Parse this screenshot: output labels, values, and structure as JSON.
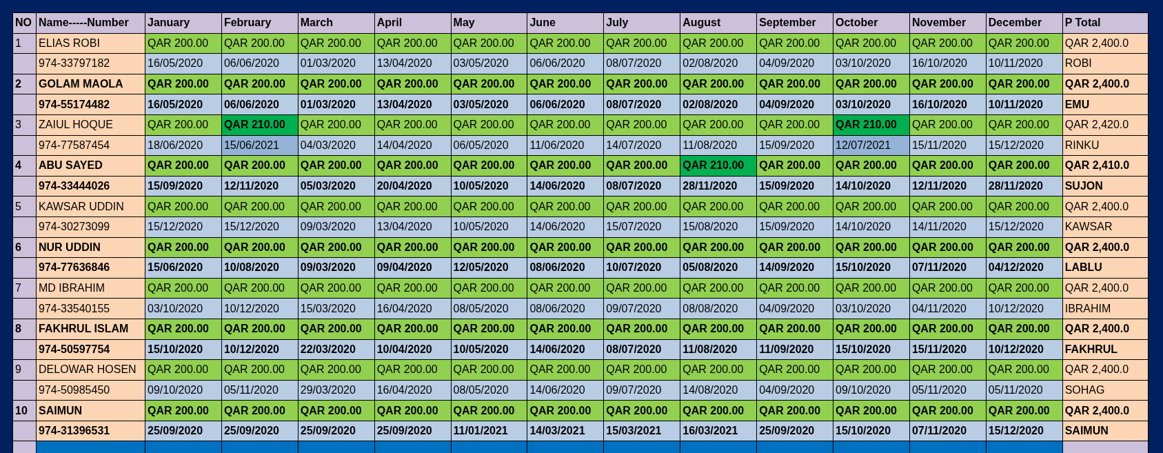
{
  "columns": [
    "NO",
    "Name-----Number",
    "January",
    "February",
    "March",
    "April",
    "May",
    "June",
    "July",
    "August",
    "September",
    "October",
    "November",
    "December",
    "P Total"
  ],
  "members": [
    {
      "no": "1",
      "name": "ELIAS ROBI",
      "phone": "974-33797182",
      "bold": false,
      "total": "QAR 2,400.0",
      "nickname": "ROBI",
      "payments": [
        {
          "amount": "QAR 200.00",
          "date": "16/05/2020",
          "amount_flagged": false,
          "date_flagged": false
        },
        {
          "amount": "QAR 200.00",
          "date": "06/06/2020",
          "amount_flagged": false,
          "date_flagged": false
        },
        {
          "amount": "QAR 200.00",
          "date": "01/03/2020",
          "amount_flagged": false,
          "date_flagged": false
        },
        {
          "amount": "QAR 200.00",
          "date": "13/04/2020",
          "amount_flagged": false,
          "date_flagged": false
        },
        {
          "amount": "QAR 200.00",
          "date": "03/05/2020",
          "amount_flagged": false,
          "date_flagged": false
        },
        {
          "amount": "QAR 200.00",
          "date": "06/06/2020",
          "amount_flagged": false,
          "date_flagged": false
        },
        {
          "amount": "QAR 200.00",
          "date": "08/07/2020",
          "amount_flagged": false,
          "date_flagged": false
        },
        {
          "amount": "QAR 200.00",
          "date": "02/08/2020",
          "amount_flagged": false,
          "date_flagged": false
        },
        {
          "amount": "QAR 200.00",
          "date": "04/09/2020",
          "amount_flagged": false,
          "date_flagged": false
        },
        {
          "amount": "QAR 200.00",
          "date": "03/10/2020",
          "amount_flagged": false,
          "date_flagged": false
        },
        {
          "amount": "QAR 200.00",
          "date": "16/10/2020",
          "amount_flagged": false,
          "date_flagged": false
        },
        {
          "amount": "QAR 200.00",
          "date": "10/11/2020",
          "amount_flagged": false,
          "date_flagged": false
        }
      ]
    },
    {
      "no": "2",
      "name": "GOLAM MAOLA",
      "phone": "974-55174482",
      "bold": true,
      "total": "QAR 2,400.0",
      "nickname": "EMU",
      "payments": [
        {
          "amount": "QAR 200.00",
          "date": "16/05/2020",
          "amount_flagged": false,
          "date_flagged": false
        },
        {
          "amount": "QAR 200.00",
          "date": "06/06/2020",
          "amount_flagged": false,
          "date_flagged": false
        },
        {
          "amount": "QAR 200.00",
          "date": "01/03/2020",
          "amount_flagged": false,
          "date_flagged": false
        },
        {
          "amount": "QAR 200.00",
          "date": "13/04/2020",
          "amount_flagged": false,
          "date_flagged": false
        },
        {
          "amount": "QAR 200.00",
          "date": "03/05/2020",
          "amount_flagged": false,
          "date_flagged": false
        },
        {
          "amount": "QAR 200.00",
          "date": "06/06/2020",
          "amount_flagged": false,
          "date_flagged": false
        },
        {
          "amount": "QAR 200.00",
          "date": "08/07/2020",
          "amount_flagged": false,
          "date_flagged": false
        },
        {
          "amount": "QAR 200.00",
          "date": "02/08/2020",
          "amount_flagged": false,
          "date_flagged": false
        },
        {
          "amount": "QAR 200.00",
          "date": "04/09/2020",
          "amount_flagged": false,
          "date_flagged": false
        },
        {
          "amount": "QAR 200.00",
          "date": "03/10/2020",
          "amount_flagged": false,
          "date_flagged": false
        },
        {
          "amount": "QAR 200.00",
          "date": "16/10/2020",
          "amount_flagged": false,
          "date_flagged": false
        },
        {
          "amount": "QAR 200.00",
          "date": "10/11/2020",
          "amount_flagged": false,
          "date_flagged": false
        }
      ]
    },
    {
      "no": "3",
      "name": "ZAIUL HOQUE",
      "phone": "974-77587454",
      "bold": false,
      "total": "QAR 2,420.0",
      "nickname": "RINKU",
      "payments": [
        {
          "amount": "QAR 200.00",
          "date": "18/06/2020",
          "amount_flagged": false,
          "date_flagged": false
        },
        {
          "amount": "QAR 210.00",
          "date": "15/06/2021",
          "amount_flagged": true,
          "date_flagged": true
        },
        {
          "amount": "QAR 200.00",
          "date": "04/03/2020",
          "amount_flagged": false,
          "date_flagged": false
        },
        {
          "amount": "QAR 200.00",
          "date": "14/04/2020",
          "amount_flagged": false,
          "date_flagged": false
        },
        {
          "amount": "QAR 200.00",
          "date": "06/05/2020",
          "amount_flagged": false,
          "date_flagged": false
        },
        {
          "amount": "QAR 200.00",
          "date": "11/06/2020",
          "amount_flagged": false,
          "date_flagged": false
        },
        {
          "amount": "QAR 200.00",
          "date": "14/07/2020",
          "amount_flagged": false,
          "date_flagged": false
        },
        {
          "amount": "QAR 200.00",
          "date": "11/08/2020",
          "amount_flagged": false,
          "date_flagged": false
        },
        {
          "amount": "QAR 200.00",
          "date": "15/09/2020",
          "amount_flagged": false,
          "date_flagged": false
        },
        {
          "amount": "QAR 210.00",
          "date": "12/07/2021",
          "amount_flagged": true,
          "date_flagged": true
        },
        {
          "amount": "QAR 200.00",
          "date": "15/11/2020",
          "amount_flagged": false,
          "date_flagged": false
        },
        {
          "amount": "QAR 200.00",
          "date": "15/12/2020",
          "amount_flagged": false,
          "date_flagged": false
        }
      ]
    },
    {
      "no": "4",
      "name": "ABU SAYED",
      "phone": "974-33444026",
      "bold": true,
      "total": "QAR 2,410.0",
      "nickname": "SUJON",
      "payments": [
        {
          "amount": "QAR 200.00",
          "date": "15/09/2020",
          "amount_flagged": false,
          "date_flagged": false
        },
        {
          "amount": "QAR 200.00",
          "date": "12/11/2020",
          "amount_flagged": false,
          "date_flagged": false
        },
        {
          "amount": "QAR 200.00",
          "date": "05/03/2020",
          "amount_flagged": false,
          "date_flagged": false
        },
        {
          "amount": "QAR 200.00",
          "date": "20/04/2020",
          "amount_flagged": false,
          "date_flagged": false
        },
        {
          "amount": "QAR 200.00",
          "date": "10/05/2020",
          "amount_flagged": false,
          "date_flagged": false
        },
        {
          "amount": "QAR 200.00",
          "date": "14/06/2020",
          "amount_flagged": false,
          "date_flagged": false
        },
        {
          "amount": "QAR 200.00",
          "date": "08/07/2020",
          "amount_flagged": false,
          "date_flagged": false
        },
        {
          "amount": "QAR 210.00",
          "date": "28/11/2020",
          "amount_flagged": true,
          "date_flagged": false
        },
        {
          "amount": "QAR 200.00",
          "date": "15/09/2020",
          "amount_flagged": false,
          "date_flagged": false
        },
        {
          "amount": "QAR 200.00",
          "date": "14/10/2020",
          "amount_flagged": false,
          "date_flagged": false
        },
        {
          "amount": "QAR 200.00",
          "date": "12/11/2020",
          "amount_flagged": false,
          "date_flagged": false
        },
        {
          "amount": "QAR 200.00",
          "date": "28/11/2020",
          "amount_flagged": false,
          "date_flagged": false
        }
      ]
    },
    {
      "no": "5",
      "name": "KAWSAR UDDIN",
      "phone": "974-30273099",
      "bold": false,
      "total": "QAR 2,400.0",
      "nickname": "KAWSAR",
      "payments": [
        {
          "amount": "QAR 200.00",
          "date": "15/12/2020",
          "amount_flagged": false,
          "date_flagged": false
        },
        {
          "amount": "QAR 200.00",
          "date": "15/12/2020",
          "amount_flagged": false,
          "date_flagged": false
        },
        {
          "amount": "QAR 200.00",
          "date": "09/03/2020",
          "amount_flagged": false,
          "date_flagged": false
        },
        {
          "amount": "QAR 200.00",
          "date": "13/04/2020",
          "amount_flagged": false,
          "date_flagged": false
        },
        {
          "amount": "QAR 200.00",
          "date": "10/05/2020",
          "amount_flagged": false,
          "date_flagged": false
        },
        {
          "amount": "QAR 200.00",
          "date": "14/06/2020",
          "amount_flagged": false,
          "date_flagged": false
        },
        {
          "amount": "QAR 200.00",
          "date": "15/07/2020",
          "amount_flagged": false,
          "date_flagged": false
        },
        {
          "amount": "QAR 200.00",
          "date": "15/08/2020",
          "amount_flagged": false,
          "date_flagged": false
        },
        {
          "amount": "QAR 200.00",
          "date": "15/09/2020",
          "amount_flagged": false,
          "date_flagged": false
        },
        {
          "amount": "QAR 200.00",
          "date": "14/10/2020",
          "amount_flagged": false,
          "date_flagged": false
        },
        {
          "amount": "QAR 200.00",
          "date": "14/11/2020",
          "amount_flagged": false,
          "date_flagged": false
        },
        {
          "amount": "QAR 200.00",
          "date": "15/12/2020",
          "amount_flagged": false,
          "date_flagged": false
        }
      ]
    },
    {
      "no": "6",
      "name": "NUR UDDIN",
      "phone": "974-77636846",
      "bold": true,
      "total": "QAR 2,400.0",
      "nickname": "LABLU",
      "payments": [
        {
          "amount": "QAR 200.00",
          "date": "15/06/2020",
          "amount_flagged": false,
          "date_flagged": false
        },
        {
          "amount": "QAR 200.00",
          "date": "10/08/2020",
          "amount_flagged": false,
          "date_flagged": false
        },
        {
          "amount": "QAR 200.00",
          "date": "09/03/2020",
          "amount_flagged": false,
          "date_flagged": false
        },
        {
          "amount": "QAR 200.00",
          "date": "09/04/2020",
          "amount_flagged": false,
          "date_flagged": false
        },
        {
          "amount": "QAR 200.00",
          "date": "12/05/2020",
          "amount_flagged": false,
          "date_flagged": false
        },
        {
          "amount": "QAR 200.00",
          "date": "08/06/2020",
          "amount_flagged": false,
          "date_flagged": false
        },
        {
          "amount": "QAR 200.00",
          "date": "10/07/2020",
          "amount_flagged": false,
          "date_flagged": false
        },
        {
          "amount": "QAR 200.00",
          "date": "05/08/2020",
          "amount_flagged": false,
          "date_flagged": false
        },
        {
          "amount": "QAR 200.00",
          "date": "14/09/2020",
          "amount_flagged": false,
          "date_flagged": false
        },
        {
          "amount": "QAR 200.00",
          "date": "15/10/2020",
          "amount_flagged": false,
          "date_flagged": false
        },
        {
          "amount": "QAR 200.00",
          "date": "07/11/2020",
          "amount_flagged": false,
          "date_flagged": false
        },
        {
          "amount": "QAR 200.00",
          "date": "04/12/2020",
          "amount_flagged": false,
          "date_flagged": false
        }
      ]
    },
    {
      "no": "7",
      "name": "MD IBRAHIM",
      "phone": "974-33540155",
      "bold": false,
      "total": "QAR 2,400.0",
      "nickname": "IBRAHIM",
      "payments": [
        {
          "amount": "QAR 200.00",
          "date": "03/10/2020",
          "amount_flagged": false,
          "date_flagged": false
        },
        {
          "amount": "QAR 200.00",
          "date": "10/12/2020",
          "amount_flagged": false,
          "date_flagged": false
        },
        {
          "amount": "QAR 200.00",
          "date": "15/03/2020",
          "amount_flagged": false,
          "date_flagged": false
        },
        {
          "amount": "QAR 200.00",
          "date": "16/04/2020",
          "amount_flagged": false,
          "date_flagged": false
        },
        {
          "amount": "QAR 200.00",
          "date": "08/05/2020",
          "amount_flagged": false,
          "date_flagged": false
        },
        {
          "amount": "QAR 200.00",
          "date": "08/06/2020",
          "amount_flagged": false,
          "date_flagged": false
        },
        {
          "amount": "QAR 200.00",
          "date": "09/07/2020",
          "amount_flagged": false,
          "date_flagged": false
        },
        {
          "amount": "QAR 200.00",
          "date": "08/08/2020",
          "amount_flagged": false,
          "date_flagged": false
        },
        {
          "amount": "QAR 200.00",
          "date": "04/09/2020",
          "amount_flagged": false,
          "date_flagged": false
        },
        {
          "amount": "QAR 200.00",
          "date": "03/10/2020",
          "amount_flagged": false,
          "date_flagged": false
        },
        {
          "amount": "QAR 200.00",
          "date": "04/11/2020",
          "amount_flagged": false,
          "date_flagged": false
        },
        {
          "amount": "QAR 200.00",
          "date": "10/12/2020",
          "amount_flagged": false,
          "date_flagged": false
        }
      ]
    },
    {
      "no": "8",
      "name": "FAKHRUL ISLAM",
      "phone": "974-50597754",
      "bold": true,
      "total": "QAR 2,400.0",
      "nickname": "FAKHRUL",
      "payments": [
        {
          "amount": "QAR 200.00",
          "date": "15/10/2020",
          "amount_flagged": false,
          "date_flagged": false
        },
        {
          "amount": "QAR 200.00",
          "date": "10/12/2020",
          "amount_flagged": false,
          "date_flagged": false
        },
        {
          "amount": "QAR 200.00",
          "date": "22/03/2020",
          "amount_flagged": false,
          "date_flagged": false
        },
        {
          "amount": "QAR 200.00",
          "date": "10/04/2020",
          "amount_flagged": false,
          "date_flagged": false
        },
        {
          "amount": "QAR 200.00",
          "date": "10/05/2020",
          "amount_flagged": false,
          "date_flagged": false
        },
        {
          "amount": "QAR 200.00",
          "date": "14/06/2020",
          "amount_flagged": false,
          "date_flagged": false
        },
        {
          "amount": "QAR 200.00",
          "date": "08/07/2020",
          "amount_flagged": false,
          "date_flagged": false
        },
        {
          "amount": "QAR 200.00",
          "date": "11/08/2020",
          "amount_flagged": false,
          "date_flagged": false
        },
        {
          "amount": "QAR 200.00",
          "date": "11/09/2020",
          "amount_flagged": false,
          "date_flagged": false
        },
        {
          "amount": "QAR 200.00",
          "date": "15/10/2020",
          "amount_flagged": false,
          "date_flagged": false
        },
        {
          "amount": "QAR 200.00",
          "date": "15/11/2020",
          "amount_flagged": false,
          "date_flagged": false
        },
        {
          "amount": "QAR 200.00",
          "date": "10/12/2020",
          "amount_flagged": false,
          "date_flagged": false
        }
      ]
    },
    {
      "no": "9",
      "name": "DELOWAR HOSEN",
      "phone": "974-50985450",
      "bold": false,
      "total": "QAR 2,400.0",
      "nickname": "SOHAG",
      "payments": [
        {
          "amount": "QAR 200.00",
          "date": "09/10/2020",
          "amount_flagged": false,
          "date_flagged": false
        },
        {
          "amount": "QAR 200.00",
          "date": "05/11/2020",
          "amount_flagged": false,
          "date_flagged": false
        },
        {
          "amount": "QAR 200.00",
          "date": "29/03/2020",
          "amount_flagged": false,
          "date_flagged": false
        },
        {
          "amount": "QAR 200.00",
          "date": "16/04/2020",
          "amount_flagged": false,
          "date_flagged": false
        },
        {
          "amount": "QAR 200.00",
          "date": "08/05/2020",
          "amount_flagged": false,
          "date_flagged": false
        },
        {
          "amount": "QAR 200.00",
          "date": "14/06/2020",
          "amount_flagged": false,
          "date_flagged": false
        },
        {
          "amount": "QAR 200.00",
          "date": "09/07/2020",
          "amount_flagged": false,
          "date_flagged": false
        },
        {
          "amount": "QAR 200.00",
          "date": "14/08/2020",
          "amount_flagged": false,
          "date_flagged": false
        },
        {
          "amount": "QAR 200.00",
          "date": "04/09/2020",
          "amount_flagged": false,
          "date_flagged": false
        },
        {
          "amount": "QAR 200.00",
          "date": "09/10/2020",
          "amount_flagged": false,
          "date_flagged": false
        },
        {
          "amount": "QAR 200.00",
          "date": "05/11/2020",
          "amount_flagged": false,
          "date_flagged": false
        },
        {
          "amount": "QAR 200.00",
          "date": "05/11/2020",
          "amount_flagged": false,
          "date_flagged": false
        }
      ]
    },
    {
      "no": "10",
      "name": "SAIMUN",
      "phone": "974-31396531",
      "bold": true,
      "total": "QAR 2,400.0",
      "nickname": "SAIMUN",
      "payments": [
        {
          "amount": "QAR 200.00",
          "date": "25/09/2020",
          "amount_flagged": false,
          "date_flagged": false
        },
        {
          "amount": "QAR 200.00",
          "date": "25/09/2020",
          "amount_flagged": false,
          "date_flagged": false
        },
        {
          "amount": "QAR 200.00",
          "date": "25/09/2020",
          "amount_flagged": false,
          "date_flagged": false
        },
        {
          "amount": "QAR 200.00",
          "date": "25/09/2020",
          "amount_flagged": false,
          "date_flagged": false
        },
        {
          "amount": "QAR 200.00",
          "date": "11/01/2021",
          "amount_flagged": false,
          "date_flagged": false
        },
        {
          "amount": "QAR 200.00",
          "date": "14/03/2021",
          "amount_flagged": false,
          "date_flagged": false
        },
        {
          "amount": "QAR 200.00",
          "date": "15/03/2021",
          "amount_flagged": false,
          "date_flagged": false
        },
        {
          "amount": "QAR 200.00",
          "date": "16/03/2021",
          "amount_flagged": false,
          "date_flagged": false
        },
        {
          "amount": "QAR 200.00",
          "date": "25/09/2020",
          "amount_flagged": false,
          "date_flagged": false
        },
        {
          "amount": "QAR 200.00",
          "date": "15/10/2020",
          "amount_flagged": false,
          "date_flagged": false
        },
        {
          "amount": "QAR 200.00",
          "date": "07/11/2020",
          "amount_flagged": false,
          "date_flagged": false
        },
        {
          "amount": "QAR 200.00",
          "date": "15/12/2020",
          "amount_flagged": false,
          "date_flagged": false
        }
      ]
    }
  ]
}
